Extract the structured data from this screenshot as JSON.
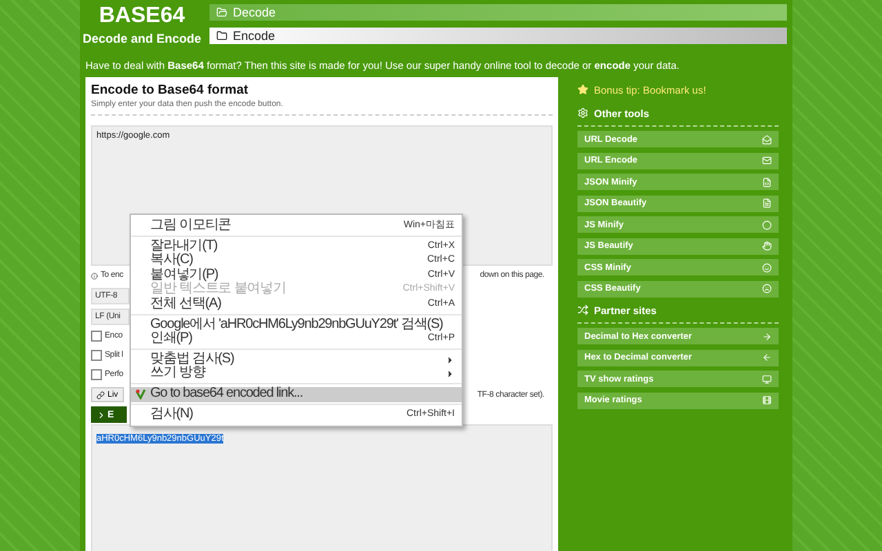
{
  "logo": {
    "title": "BASE64",
    "subtitle": "Decode and Encode"
  },
  "nav": [
    {
      "label": "Decode",
      "selected": false
    },
    {
      "label": "Encode",
      "selected": true
    }
  ],
  "intro": "Have to deal with **Base64** format? Then this site is made for you! Use our super handy online tool to decode or **encode** your data.",
  "card": {
    "title": "Encode to Base64 format",
    "subtitle": "Simply enter your data then push the encode button.",
    "input": "https://google.com",
    "info_start": "To enc",
    "info_end": "down on this page.",
    "selects": [
      "UTF-8",
      "LF (Uni"
    ],
    "options": [
      {
        "label": "Enco",
        "checked": false
      },
      {
        "label": "Split l",
        "checked": false
      },
      {
        "label": "Perfo",
        "checked": false
      }
    ],
    "live_button": "Liv",
    "live_note": "TF-8 character set).",
    "encode_button": "E",
    "output": "aHR0cHM6Ly9nb29nbGUuY29t"
  },
  "context_menu": [
    {
      "kind": "item",
      "label": "그림 이모티콘",
      "shortcut": "Win+마침표",
      "disabled": false,
      "selected": false
    },
    {
      "kind": "separator"
    },
    {
      "kind": "item",
      "label": "잘라내기(T)",
      "shortcut": "Ctrl+X",
      "disabled": false,
      "selected": false
    },
    {
      "kind": "item",
      "label": "복사(C)",
      "shortcut": "Ctrl+C",
      "disabled": false,
      "selected": false
    },
    {
      "kind": "item",
      "label": "붙여넣기(P)",
      "shortcut": "Ctrl+V",
      "disabled": false,
      "selected": false
    },
    {
      "kind": "item",
      "label": "일반 텍스트로 붙여넣기",
      "shortcut": "Ctrl+Shift+V",
      "disabled": true,
      "selected": false
    },
    {
      "kind": "item",
      "label": "전체 선택(A)",
      "shortcut": "Ctrl+A",
      "disabled": false,
      "selected": false
    },
    {
      "kind": "separator"
    },
    {
      "kind": "item",
      "label": "Google에서 'aHR0cHM6Ly9nb29nbGUuY29t' 검색(S)",
      "disabled": false,
      "selected": false
    },
    {
      "kind": "item",
      "label": "인쇄(P)",
      "shortcut": "Ctrl+P",
      "disabled": false,
      "selected": false
    },
    {
      "kind": "separator"
    },
    {
      "kind": "submenu",
      "label": "맞춤법 검사(S)",
      "disabled": false,
      "selected": false
    },
    {
      "kind": "submenu",
      "label": "쓰기 방향",
      "disabled": false,
      "selected": false
    },
    {
      "kind": "separator"
    },
    {
      "kind": "extension",
      "label": "Go to base64 encoded link...",
      "disabled": false,
      "selected": true
    },
    {
      "kind": "separator"
    },
    {
      "kind": "item",
      "label": "검사(N)",
      "shortcut": "Ctrl+Shift+I",
      "disabled": false,
      "selected": false
    }
  ],
  "sidebar": {
    "tip": "Bonus tip: Bookmark us!",
    "tools_title": "Other tools",
    "tools": [
      "URL Decode",
      "URL Encode",
      "JSON Minify",
      "JSON Beautify",
      "JS Minify",
      "JS Beautify",
      "CSS Minify",
      "CSS Beautify"
    ],
    "partners_title": "Partner sites",
    "partners": [
      "Decimal to Hex converter",
      "Hex to Decimal converter",
      "TV show ratings",
      "Movie ratings"
    ]
  }
}
